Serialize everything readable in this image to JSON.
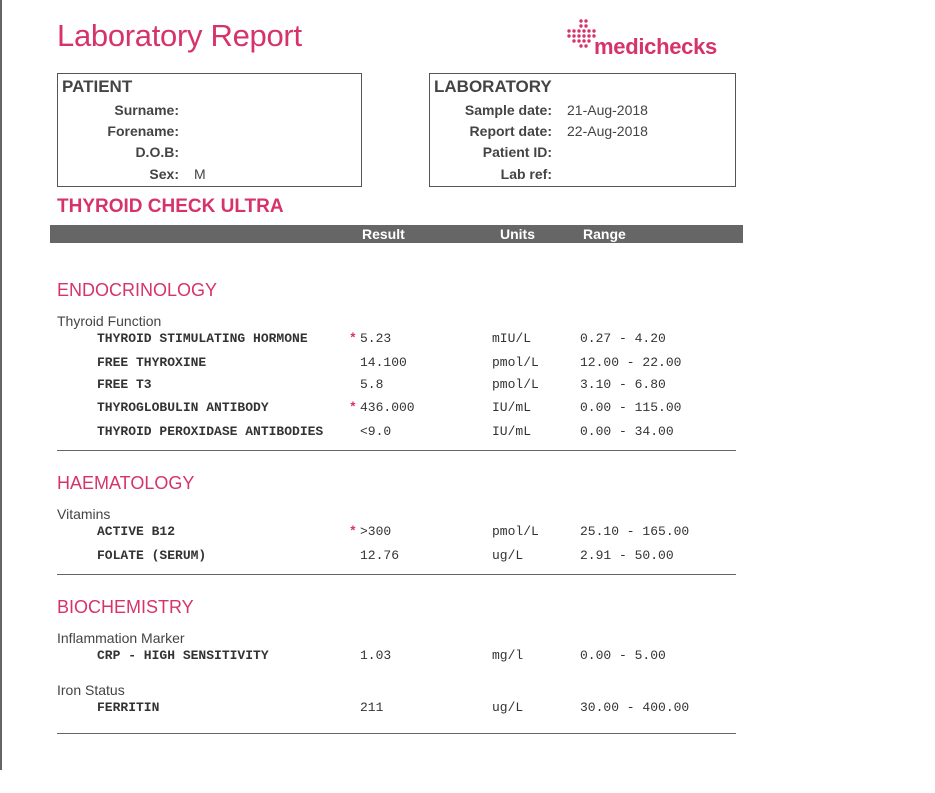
{
  "title": "Laboratory Report",
  "logo": {
    "part1": "medi",
    "part2": "checks"
  },
  "patient": {
    "title": "PATIENT",
    "fields": [
      {
        "label": "Surname:",
        "value": ""
      },
      {
        "label": "Forename:",
        "value": ""
      },
      {
        "label": "D.O.B:",
        "value": ""
      },
      {
        "label": "Sex:",
        "value": "M"
      }
    ]
  },
  "laboratory": {
    "title": "LABORATORY",
    "fields": [
      {
        "label": "Sample date:",
        "value": "21-Aug-2018"
      },
      {
        "label": "Report date:",
        "value": "22-Aug-2018"
      },
      {
        "label": "Patient ID:",
        "value": ""
      },
      {
        "label": "Lab ref:",
        "value": ""
      }
    ]
  },
  "panel_title": "THYROID CHECK ULTRA",
  "table_header": {
    "result": "Result",
    "units": "Units",
    "range": "Range"
  },
  "sections": [
    {
      "name": "ENDOCRINOLOGY",
      "groups": [
        {
          "name": "Thyroid Function",
          "rows": [
            {
              "test": "THYROID STIMULATING HORMONE",
              "flag": "*",
              "result": "5.23",
              "units": "mIU/L",
              "range": "0.27 - 4.20"
            },
            {
              "test": "FREE THYROXINE",
              "flag": "",
              "result": "14.100",
              "units": "pmol/L",
              "range": "12.00 - 22.00"
            },
            {
              "test": "FREE T3",
              "flag": "",
              "result": "5.8",
              "units": "pmol/L",
              "range": "3.10 - 6.80"
            },
            {
              "test": "THYROGLOBULIN ANTIBODY",
              "flag": "*",
              "result": "436.000",
              "units": "IU/mL",
              "range": "0.00 - 115.00"
            },
            {
              "test": "THYROID PEROXIDASE ANTIBODIES",
              "flag": "",
              "result": "<9.0",
              "units": "IU/mL",
              "range": "0.00 - 34.00"
            }
          ]
        }
      ]
    },
    {
      "name": "HAEMATOLOGY",
      "groups": [
        {
          "name": "Vitamins",
          "rows": [
            {
              "test": "ACTIVE B12",
              "flag": "*",
              "result": ">300",
              "units": "pmol/L",
              "range": "25.10 - 165.00"
            },
            {
              "test": "FOLATE (SERUM)",
              "flag": "",
              "result": "12.76",
              "units": "ug/L",
              "range": "2.91 - 50.00"
            }
          ]
        }
      ]
    },
    {
      "name": "BIOCHEMISTRY",
      "groups": [
        {
          "name": "Inflammation Marker",
          "rows": [
            {
              "test": "CRP - HIGH SENSITIVITY",
              "flag": "",
              "result": "1.03",
              "units": "mg/l",
              "range": "0.00 - 5.00"
            }
          ]
        },
        {
          "name": "Iron Status",
          "rows": [
            {
              "test": "FERRITIN",
              "flag": "",
              "result": "211",
              "units": "ug/L",
              "range": "30.00 - 400.00"
            }
          ]
        }
      ]
    }
  ],
  "colors": {
    "accent": "#d6336c",
    "header_bar": "#666666",
    "text": "#333333"
  }
}
